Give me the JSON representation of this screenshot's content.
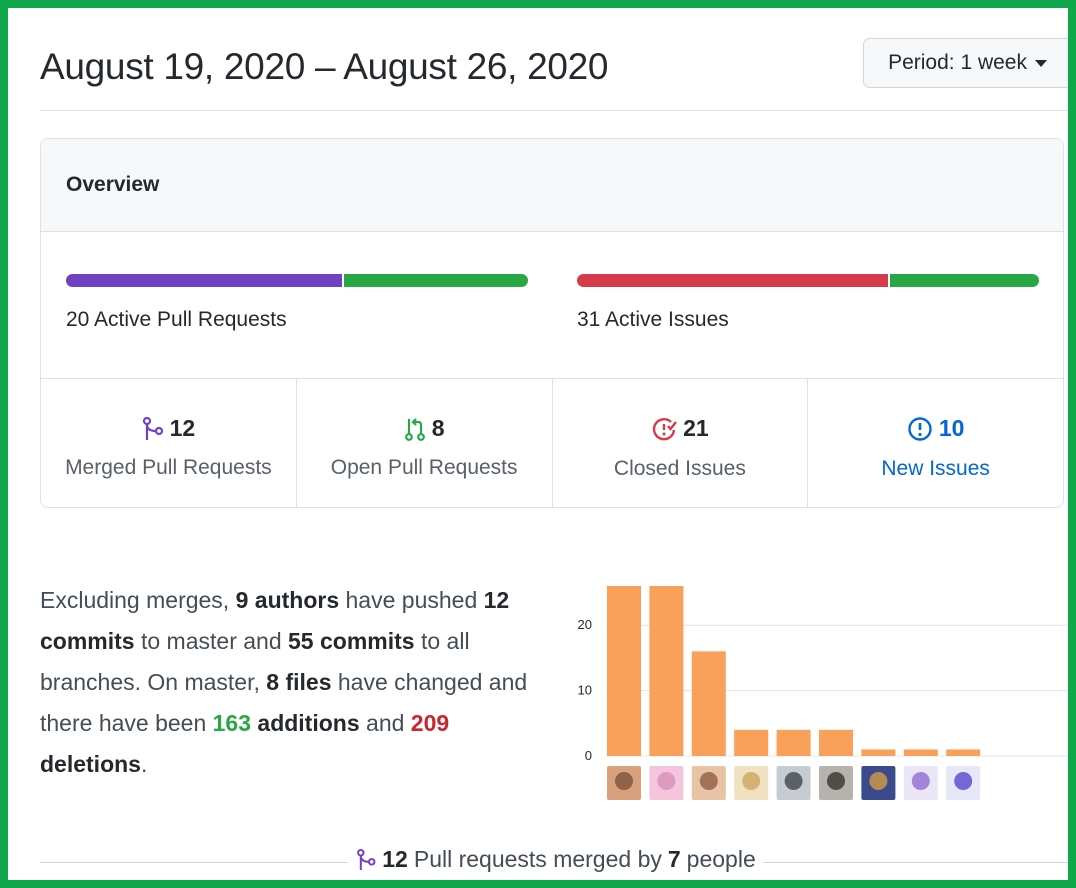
{
  "header": {
    "title": "August 19, 2020 – August 26, 2020",
    "period_button": "Period: 1 week"
  },
  "overview": {
    "heading": "Overview",
    "pull_requests": {
      "label": "20 Active Pull Requests",
      "merged_fraction": 0.6,
      "open_fraction": 0.4
    },
    "issues": {
      "label": "31 Active Issues",
      "closed_fraction": 0.677,
      "new_fraction": 0.323
    },
    "stats": [
      {
        "count": "12",
        "label": "Merged Pull Requests",
        "icon": "git-merge-icon"
      },
      {
        "count": "8",
        "label": "Open Pull Requests",
        "icon": "git-pull-request-icon"
      },
      {
        "count": "21",
        "label": "Closed Issues",
        "icon": "issue-closed-icon"
      },
      {
        "count": "10",
        "label": "New Issues",
        "icon": "issue-opened-icon"
      }
    ]
  },
  "summary": {
    "t1": "Excluding merges, ",
    "authors": "9 authors",
    "t2": " have pushed ",
    "commits_master": "12 commits",
    "t3": " to master and ",
    "commits_all": "55 commits",
    "t4": " to all branches. On master, ",
    "files": "8 files",
    "t5": " have changed and there have been ",
    "additions_num": "163",
    "additions_word": " additions",
    "t6": " and ",
    "deletions_num": "209",
    "deletions_word": " deletions",
    "t7": "."
  },
  "colors": {
    "merged": "#6f42c1",
    "open": "#28a745",
    "closed": "#d73a49",
    "new": "#28a745",
    "bar": "#f9a05a",
    "link": "#0366d6",
    "border": "#0fa84a"
  },
  "chart_data": {
    "type": "bar",
    "categories": [
      "author-1",
      "author-2",
      "author-3",
      "author-4",
      "author-5",
      "author-6",
      "author-7",
      "author-8",
      "author-9"
    ],
    "values": [
      26,
      26,
      16,
      4,
      4,
      4,
      1,
      1,
      1
    ],
    "ylim": [
      0,
      26
    ],
    "yticks": [
      0,
      10,
      20
    ],
    "grid": true,
    "legend": "none"
  },
  "footer": {
    "count": "12",
    "t1": " Pull requests merged by ",
    "people": "7",
    "t2": " people"
  }
}
